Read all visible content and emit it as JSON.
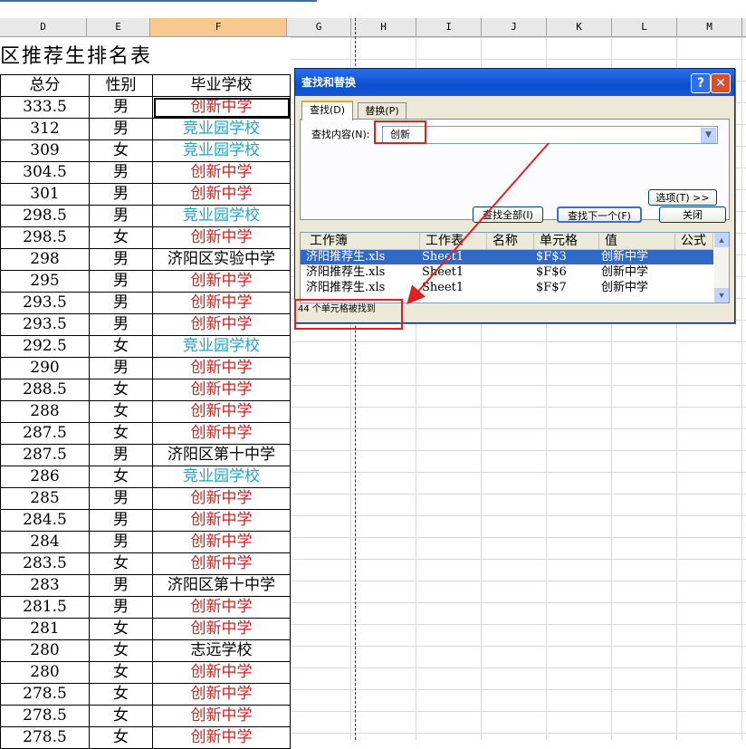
{
  "columns": [
    {
      "label": "D",
      "w": 96
    },
    {
      "label": "E",
      "w": 70
    },
    {
      "label": "F",
      "w": 151,
      "selected": true
    },
    {
      "label": "G",
      "w": 71
    },
    {
      "label": "H",
      "w": 72
    },
    {
      "label": "I",
      "w": 72
    },
    {
      "label": "J",
      "w": 72
    },
    {
      "label": "K",
      "w": 72
    },
    {
      "label": "L",
      "w": 72
    },
    {
      "label": "M",
      "w": 72
    }
  ],
  "sheet": {
    "title": "区推荐生排名表",
    "headers": [
      "总分",
      "性别",
      "毕业学校"
    ],
    "rows": [
      [
        "333.5",
        "男",
        "创新中学"
      ],
      [
        "312",
        "男",
        "竞业园学校"
      ],
      [
        "309",
        "女",
        "竞业园学校"
      ],
      [
        "304.5",
        "男",
        "创新中学"
      ],
      [
        "301",
        "男",
        "创新中学"
      ],
      [
        "298.5",
        "男",
        "竞业园学校"
      ],
      [
        "298.5",
        "女",
        "创新中学"
      ],
      [
        "298",
        "男",
        "济阳区实验中学"
      ],
      [
        "295",
        "男",
        "创新中学"
      ],
      [
        "293.5",
        "男",
        "创新中学"
      ],
      [
        "293.5",
        "男",
        "创新中学"
      ],
      [
        "292.5",
        "女",
        "竞业园学校"
      ],
      [
        "290",
        "男",
        "创新中学"
      ],
      [
        "288.5",
        "女",
        "创新中学"
      ],
      [
        "288",
        "女",
        "创新中学"
      ],
      [
        "287.5",
        "女",
        "创新中学"
      ],
      [
        "287.5",
        "男",
        "济阳区第十中学"
      ],
      [
        "286",
        "女",
        "竞业园学校"
      ],
      [
        "285",
        "男",
        "创新中学"
      ],
      [
        "284.5",
        "男",
        "创新中学"
      ],
      [
        "284",
        "男",
        "创新中学"
      ],
      [
        "283.5",
        "女",
        "创新中学"
      ],
      [
        "283",
        "男",
        "济阳区第十中学"
      ],
      [
        "281.5",
        "男",
        "创新中学"
      ],
      [
        "281",
        "女",
        "创新中学"
      ],
      [
        "280",
        "女",
        "志远学校"
      ],
      [
        "280",
        "女",
        "创新中学"
      ],
      [
        "278.5",
        "女",
        "创新中学"
      ],
      [
        "278.5",
        "女",
        "创新中学"
      ],
      [
        "278.5",
        "女",
        "创新中学"
      ]
    ]
  },
  "school_colors": {
    "创新中学": "#d02020",
    "竞业园学校": "#1aa6c8",
    "default": "#000000"
  },
  "dialog": {
    "title": "查找和替换",
    "help": "?",
    "close": "✕",
    "tab_find": "查找(D)",
    "tab_replace": "替换(P)",
    "find_label": "查找内容(N):",
    "find_value": "创新",
    "options_button": "选项(T) >>",
    "find_all_button": "查找全部(I)",
    "find_next_button": "查找下一个(F)",
    "close_button": "关闭",
    "result_headers": [
      "工作簿",
      "工作表",
      "名称",
      "单元格",
      "值",
      "公式"
    ],
    "results": [
      [
        "济阳推荐生.xls",
        "Sheet1",
        "",
        "$F$3",
        "创新中学",
        ""
      ],
      [
        "济阳推荐生.xls",
        "Sheet1",
        "",
        "$F$6",
        "创新中学",
        ""
      ],
      [
        "济阳推荐生.xls",
        "Sheet1",
        "",
        "$F$7",
        "创新中学",
        ""
      ]
    ],
    "status": "44 个单元格被找到"
  }
}
